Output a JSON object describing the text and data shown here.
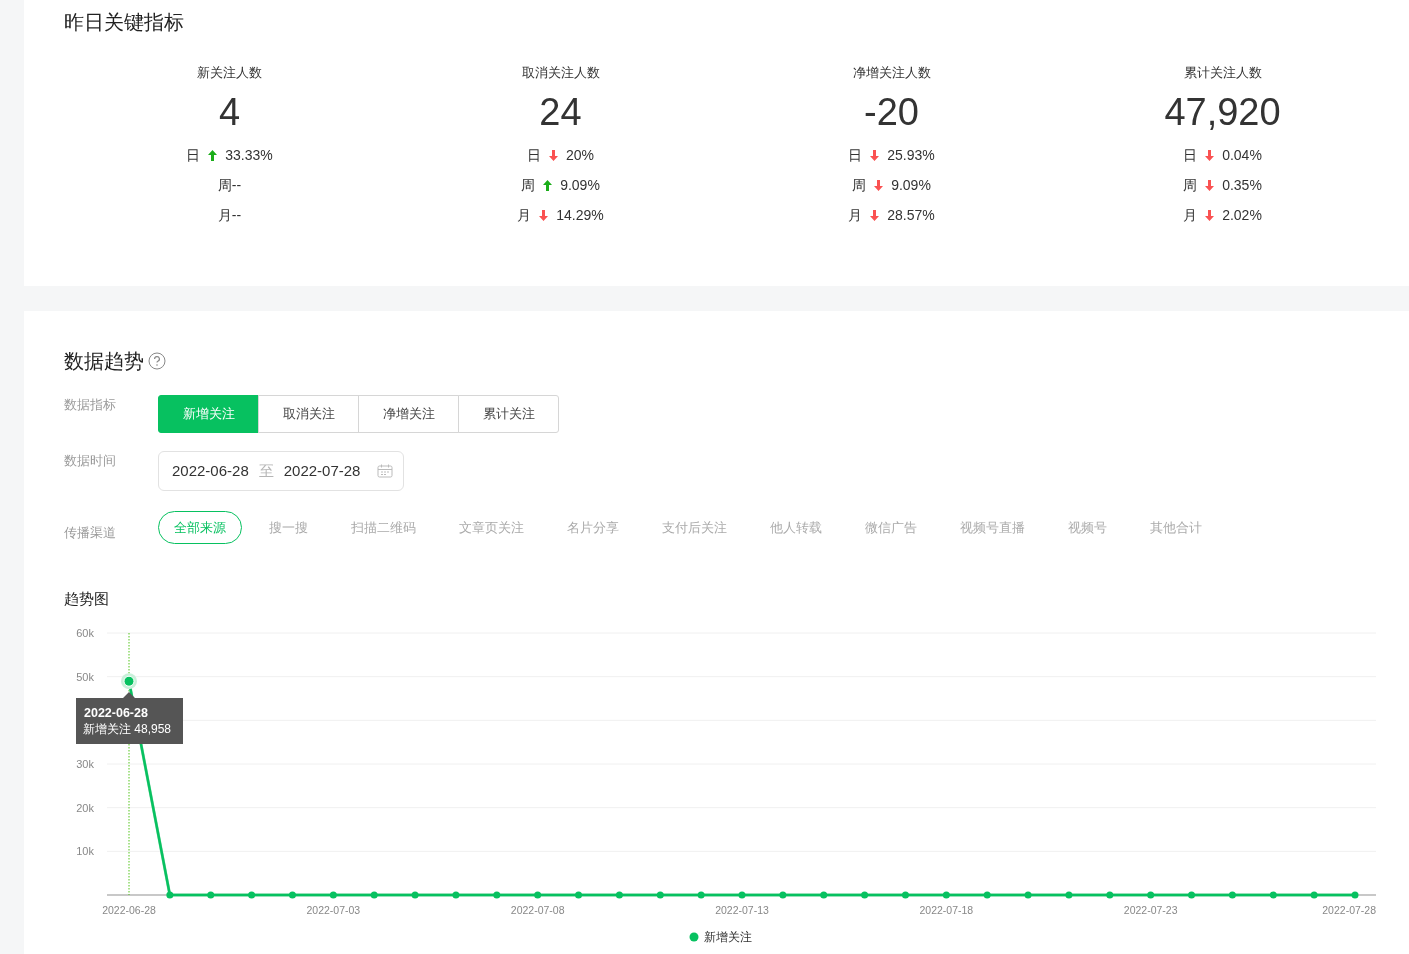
{
  "yesterday": {
    "title": "昨日关键指标",
    "metrics": [
      {
        "label": "新关注人数",
        "value": "4",
        "changes": [
          {
            "period": "日",
            "kind": "up",
            "value": "33.33%"
          },
          {
            "period": "周",
            "kind": "plain",
            "value": "--"
          },
          {
            "period": "月",
            "kind": "plain",
            "value": "--"
          }
        ]
      },
      {
        "label": "取消关注人数",
        "value": "24",
        "changes": [
          {
            "period": "日",
            "kind": "down",
            "value": "20%"
          },
          {
            "period": "周",
            "kind": "up",
            "value": "9.09%"
          },
          {
            "period": "月",
            "kind": "down",
            "value": "14.29%"
          }
        ]
      },
      {
        "label": "净增关注人数",
        "value": "-20",
        "changes": [
          {
            "period": "日",
            "kind": "down",
            "value": "25.93%"
          },
          {
            "period": "周",
            "kind": "down",
            "value": "9.09%"
          },
          {
            "period": "月",
            "kind": "down",
            "value": "28.57%"
          }
        ]
      },
      {
        "label": "累计关注人数",
        "value": "47,920",
        "changes": [
          {
            "period": "日",
            "kind": "down",
            "value": "0.04%"
          },
          {
            "period": "周",
            "kind": "down",
            "value": "0.35%"
          },
          {
            "period": "月",
            "kind": "down",
            "value": "2.02%"
          }
        ]
      }
    ]
  },
  "trend": {
    "title": "数据趋势",
    "filters": [
      {
        "label": "数据指标",
        "kind": "segmented",
        "options": [
          {
            "label": "新增关注",
            "selected": true
          },
          {
            "label": "取消关注",
            "selected": false
          },
          {
            "label": "净增关注",
            "selected": false
          },
          {
            "label": "累计关注",
            "selected": false
          }
        ]
      },
      {
        "label": "数据时间",
        "kind": "daterange",
        "start": "2022-06-28",
        "separator": "至",
        "end": "2022-07-28"
      },
      {
        "label": "传播渠道",
        "kind": "pills",
        "options": [
          {
            "label": "全部来源",
            "selected": true
          },
          {
            "label": "搜一搜",
            "selected": false
          },
          {
            "label": "扫描二维码",
            "selected": false
          },
          {
            "label": "文章页关注",
            "selected": false
          },
          {
            "label": "名片分享",
            "selected": false
          },
          {
            "label": "支付后关注",
            "selected": false
          },
          {
            "label": "他人转载",
            "selected": false
          },
          {
            "label": "微信广告",
            "selected": false
          },
          {
            "label": "视频号直播",
            "selected": false
          },
          {
            "label": "视频号",
            "selected": false
          },
          {
            "label": "其他合计",
            "selected": false
          }
        ]
      }
    ],
    "chart_title": "趋势图",
    "chart_data": {
      "type": "line",
      "categories": [
        "2022-06-28",
        null,
        null,
        null,
        null,
        "2022-07-03",
        null,
        null,
        null,
        null,
        "2022-07-08",
        null,
        null,
        null,
        null,
        "2022-07-13",
        null,
        null,
        null,
        null,
        "2022-07-18",
        null,
        null,
        null,
        null,
        "2022-07-23",
        null,
        null,
        null,
        null,
        "2022-07-28"
      ],
      "series": [
        {
          "name": "新增关注",
          "color": "#07c160",
          "marker": "circle",
          "values": [
            48958,
            0,
            0,
            0,
            0,
            0,
            0,
            0,
            0,
            0,
            0,
            0,
            0,
            0,
            0,
            0,
            0,
            0,
            0,
            0,
            0,
            0,
            0,
            0,
            0,
            0,
            0,
            0,
            0,
            0,
            0
          ]
        }
      ],
      "ylim": [
        0,
        60000
      ],
      "yticks": [
        {
          "value": 10000,
          "label": "10k"
        },
        {
          "value": 20000,
          "label": "20k"
        },
        {
          "value": 30000,
          "label": "30k"
        },
        {
          "value": 50000,
          "label": "50k"
        },
        {
          "value": 60000,
          "label": "60k"
        }
      ],
      "grid": true
    },
    "tooltip": {
      "title": "2022-06-28",
      "label": "新增关注",
      "value": "48,958"
    }
  }
}
